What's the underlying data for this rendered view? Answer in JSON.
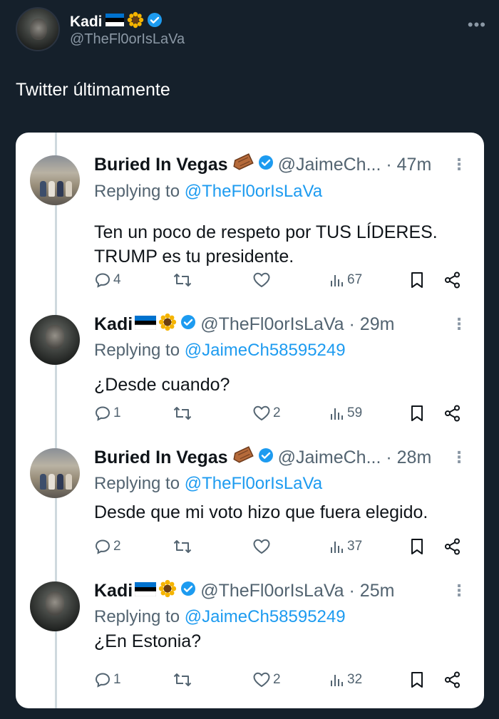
{
  "post": {
    "author_name": "Kadi",
    "author_handle": "@TheFl0orIsLaVa",
    "text": "Twitter últimamente",
    "more_icon": "more-horizontal-icon"
  },
  "colors": {
    "background": "#15202b",
    "link": "#1d9bf0",
    "verified": "#1d9bf0",
    "muted": "#536471"
  },
  "thread": [
    {
      "name": "Buried In Vegas",
      "handle_time": "@JaimeCh... · 47m",
      "reply_label": "Replying to",
      "reply_to": "@TheFl0orIsLaVa",
      "text": [
        "Ten un poco de respeto por TUS LÍDERES.",
        "TRUMP es tu presidente."
      ],
      "replies": "4",
      "retweets": "",
      "likes": "",
      "views": "67",
      "badge_emoji": "coffin-icon"
    },
    {
      "name": "Kadi",
      "handle_time": "@TheFl0orIsLaVa · 29m",
      "reply_label": "Replying to",
      "reply_to": "@JaimeCh58595249",
      "text": [
        "¿Desde cuando?"
      ],
      "replies": "1",
      "retweets": "",
      "likes": "2",
      "views": "59",
      "badge_emoji": "estonia-flag-sunflower-icon"
    },
    {
      "name": "Buried In Vegas",
      "handle_time": "@JaimeCh... · 28m",
      "reply_label": "Replying to",
      "reply_to": "@TheFl0orIsLaVa",
      "text": [
        "Desde que mi voto hizo que fuera elegido."
      ],
      "replies": "2",
      "retweets": "",
      "likes": "",
      "views": "37",
      "badge_emoji": "coffin-icon"
    },
    {
      "name": "Kadi",
      "handle_time": "@TheFl0orIsLaVa · 25m",
      "reply_label": "Replying to",
      "reply_to": "@JaimeCh58595249",
      "text": [
        "¿En Estonia?"
      ],
      "replies": "1",
      "retweets": "",
      "likes": "2",
      "views": "32",
      "badge_emoji": "estonia-flag-sunflower-icon"
    }
  ]
}
